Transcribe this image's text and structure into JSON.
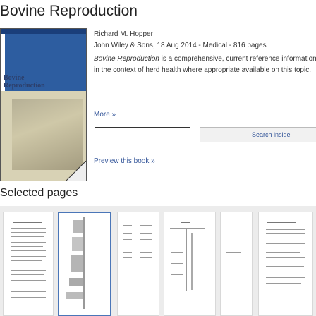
{
  "page": {
    "title": "Bovine Reproduction"
  },
  "cover": {
    "title_line1": "Bovine",
    "title_line2": "Reproduction",
    "colors": {
      "band": "#1a3e7a",
      "blue": "#2d5da0",
      "beige": "#d8d2b5"
    }
  },
  "book": {
    "author": "Richard M. Hopper",
    "publication": "John Wiley & Sons, 18 Aug 2014 - Medical - 816 pages",
    "description_title": "Bovine Reproduction",
    "description_rest": " is a comprehensive, current reference information in the context of herd health where appropriate available on this topic.",
    "more_label": "More »"
  },
  "search": {
    "button_label": "Search inside"
  },
  "preview": {
    "label": "Preview this book »"
  },
  "selected_pages": {
    "title": "Selected pages",
    "count": 6
  },
  "colors": {
    "link": "#335599",
    "selected_border": "#4a76b8"
  }
}
